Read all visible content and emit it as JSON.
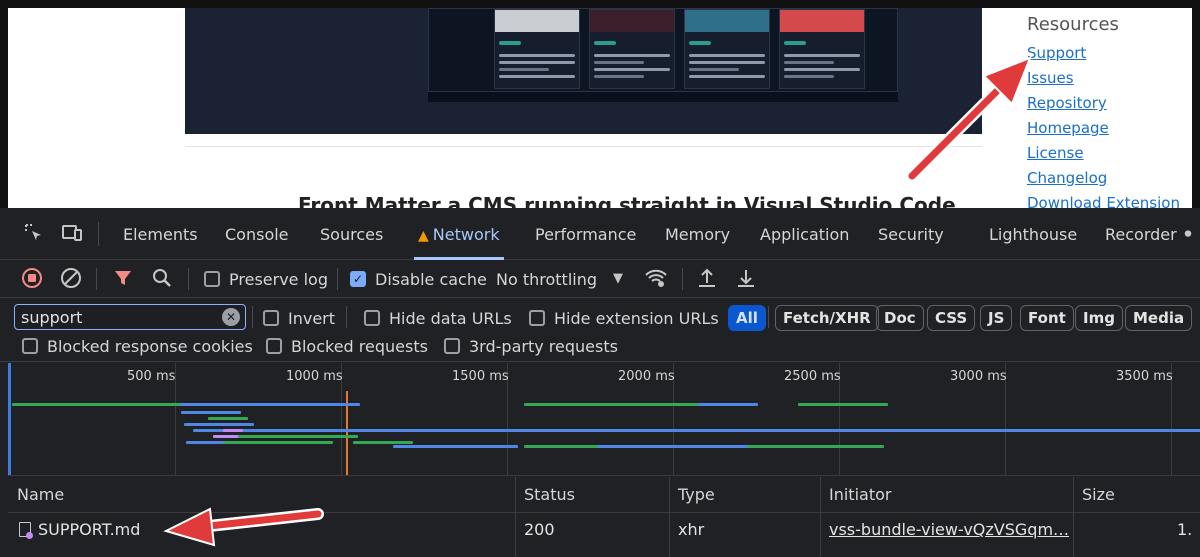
{
  "page": {
    "heading": "Front Matter a CMS running straight in Visual Studio Code",
    "resources": {
      "title": "Resources",
      "links": [
        "Support",
        "Issues",
        "Repository",
        "Homepage",
        "License",
        "Changelog",
        "Download Extension"
      ]
    }
  },
  "devtools": {
    "tabs": [
      "Elements",
      "Console",
      "Sources",
      "Network",
      "Performance",
      "Memory",
      "Application",
      "Security",
      "Lighthouse",
      "Recorder"
    ],
    "active_tab": "Network",
    "toolbar": {
      "preserve_log": "Preserve log",
      "disable_cache": "Disable cache",
      "throttling": "No throttling"
    },
    "filter": {
      "value": "support",
      "invert": "Invert",
      "hide_data_urls": "Hide data URLs",
      "hide_extension_urls": "Hide extension URLs",
      "types": [
        "All",
        "Fetch/XHR",
        "Doc",
        "CSS",
        "JS",
        "Font",
        "Img",
        "Media"
      ],
      "active_type": "All"
    },
    "options": {
      "blocked_cookies": "Blocked response cookies",
      "blocked_requests": "Blocked requests",
      "third_party": "3rd-party requests"
    },
    "timeline": {
      "ticks": [
        "500 ms",
        "1000 ms",
        "1500 ms",
        "2000 ms",
        "2500 ms",
        "3000 ms",
        "3500 ms"
      ]
    },
    "table": {
      "columns": [
        "Name",
        "Status",
        "Type",
        "Initiator",
        "Size"
      ],
      "rows": [
        {
          "name": "SUPPORT.md",
          "status": "200",
          "type": "xhr",
          "initiator": "vss-bundle-view-vQzVSGqm…",
          "size": "1."
        }
      ]
    },
    "colors": {
      "accent": "#a8c7fa",
      "warning": "#f29900",
      "annotation_arrow": "#e03a3a"
    }
  }
}
